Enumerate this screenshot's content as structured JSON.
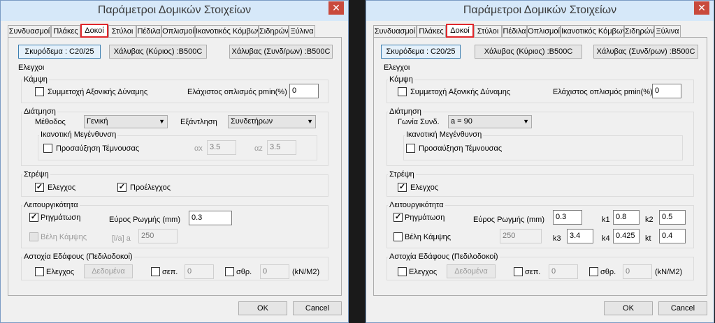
{
  "left": {
    "title": "Παράμετροι Δομικών Στοιχείων",
    "close_glyph": "✕",
    "tabs": [
      "Συνδυασμοί",
      "Πλάκες",
      "Δοκοί",
      "Στύλοι",
      "Πέδιλα",
      "Οπλισμοί",
      "Ικανοτικός Κόμβων",
      "Σιδηρών",
      "Ξύλινα"
    ],
    "active_tab": "Δοκοί",
    "materials": {
      "concrete": "Σκυρόδεμα : C20/25",
      "steel_main": "Χάλυβας  (Κύριος) :B500C",
      "steel_secondary": "Χάλυβας  (Συνδ/ρων) :B500C"
    },
    "checks_label": "Ελεγχοι",
    "bending": {
      "label": "Κάμψη",
      "axial_label": "Συμμετοχή Αξονικής Δύναμης",
      "axial_checked": false,
      "pmin_label": "Ελάχιστος οπλισμός pmin(%)",
      "pmin_value": "0"
    },
    "shear": {
      "label": "Διάτμηση",
      "method_label": "Μέθοδος",
      "method_value": "Γενική",
      "exhaust_label": "Εξάντληση",
      "exhaust_value": "Συνδετήρων",
      "capacity_label": "Ικανοτική Μεγένθυνση",
      "increase_label": "Προσαύξηση Τέμνουσας",
      "increase_checked": false,
      "ax_label": "αx",
      "ax_value": "3.5",
      "az_label": "αz",
      "az_value": "3.5"
    },
    "torsion": {
      "label": "Στρέψη",
      "check_label": "Ελεγχος",
      "check_checked": true,
      "precheck_label": "Προέλεγχος",
      "precheck_checked": true
    },
    "service": {
      "label": "Λειτουργικότητα",
      "crack_label": "Ρηγμάτωση",
      "crack_checked": true,
      "width_label": "Εύρος Ρωγμής (mm)",
      "width_value": "0.3",
      "defl_label": "Βέλη Κάμψης",
      "defl_checked": false,
      "ratio_label": "[l/a] a",
      "ratio_value": "250"
    },
    "soil": {
      "label": "Αστοχία Εδάφους (Πεδιλοδοκοί)",
      "check_label": "Ελεγχος",
      "check_checked": false,
      "data_label": "Δεδομένα",
      "sep_label": "σεπ.",
      "sep_value": "0",
      "sthr_label": "σθρ.",
      "sthr_value": "0",
      "unit": "(kN/M2)"
    },
    "ok_label": "OK",
    "cancel_label": "Cancel"
  },
  "right": {
    "title": "Παράμετροι Δομικών Στοιχείων",
    "close_glyph": "✕",
    "tabs": [
      "Συνδυασμοί",
      "Πλάκες",
      "Δοκοί",
      "Στύλοι",
      "Πέδιλα",
      "Οπλισμοί",
      "Ικανοτικός Κόμβων",
      "Σιδηρών",
      "Ξύλινα"
    ],
    "active_tab": "Δοκοί",
    "materials": {
      "concrete": "Σκυρόδεμα : C20/25",
      "steel_main": "Χάλυβας  (Κύριος) :B500C",
      "steel_secondary": "Χάλυβας  (Συνδ/ρων) :B500C"
    },
    "checks_label": "Ελεγχοι",
    "bending": {
      "label": "Κάμψη",
      "axial_label": "Συμμετοχή Αξονικής Δύναμης",
      "axial_checked": false,
      "pmin_label": "Ελάχιστος οπλισμός pmin(%)",
      "pmin_value": "0"
    },
    "shear": {
      "label": "Διάτμηση",
      "angle_label": "Γωνία Συνδ.",
      "angle_value": "a = 90",
      "capacity_label": "Ικανοτική Μεγένθυνση",
      "increase_label": "Προσαύξηση Τέμνουσας",
      "increase_checked": false
    },
    "torsion": {
      "label": "Στρέψη",
      "check_label": "Ελεγχος",
      "check_checked": true
    },
    "service": {
      "label": "Λειτουργικότητα",
      "crack_label": "Ρηγμάτωση",
      "crack_checked": true,
      "width_label": "Εύρος Ρωγμής (mm)",
      "width_value": "0.3",
      "k1_label": "k1",
      "k1_value": "0.8",
      "k2_label": "k2",
      "k2_value": "0.5",
      "defl_label": "Βέλη Κάμψης",
      "defl_checked": false,
      "ratio_value": "250",
      "k3_label": "k3",
      "k3_value": "3.4",
      "k4_label": "k4",
      "k4_value": "0.425",
      "kt_label": "kt",
      "kt_value": "0.4"
    },
    "soil": {
      "label": "Αστοχία Εδάφους (Πεδιλοδοκοί)",
      "check_label": "Ελεγχος",
      "check_checked": false,
      "data_label": "Δεδομένα",
      "sep_label": "σεπ.",
      "sep_value": "0",
      "sthr_label": "σθρ.",
      "sthr_value": "0",
      "unit": "(kN/M2)"
    },
    "ok_label": "OK",
    "cancel_label": "Cancel"
  }
}
